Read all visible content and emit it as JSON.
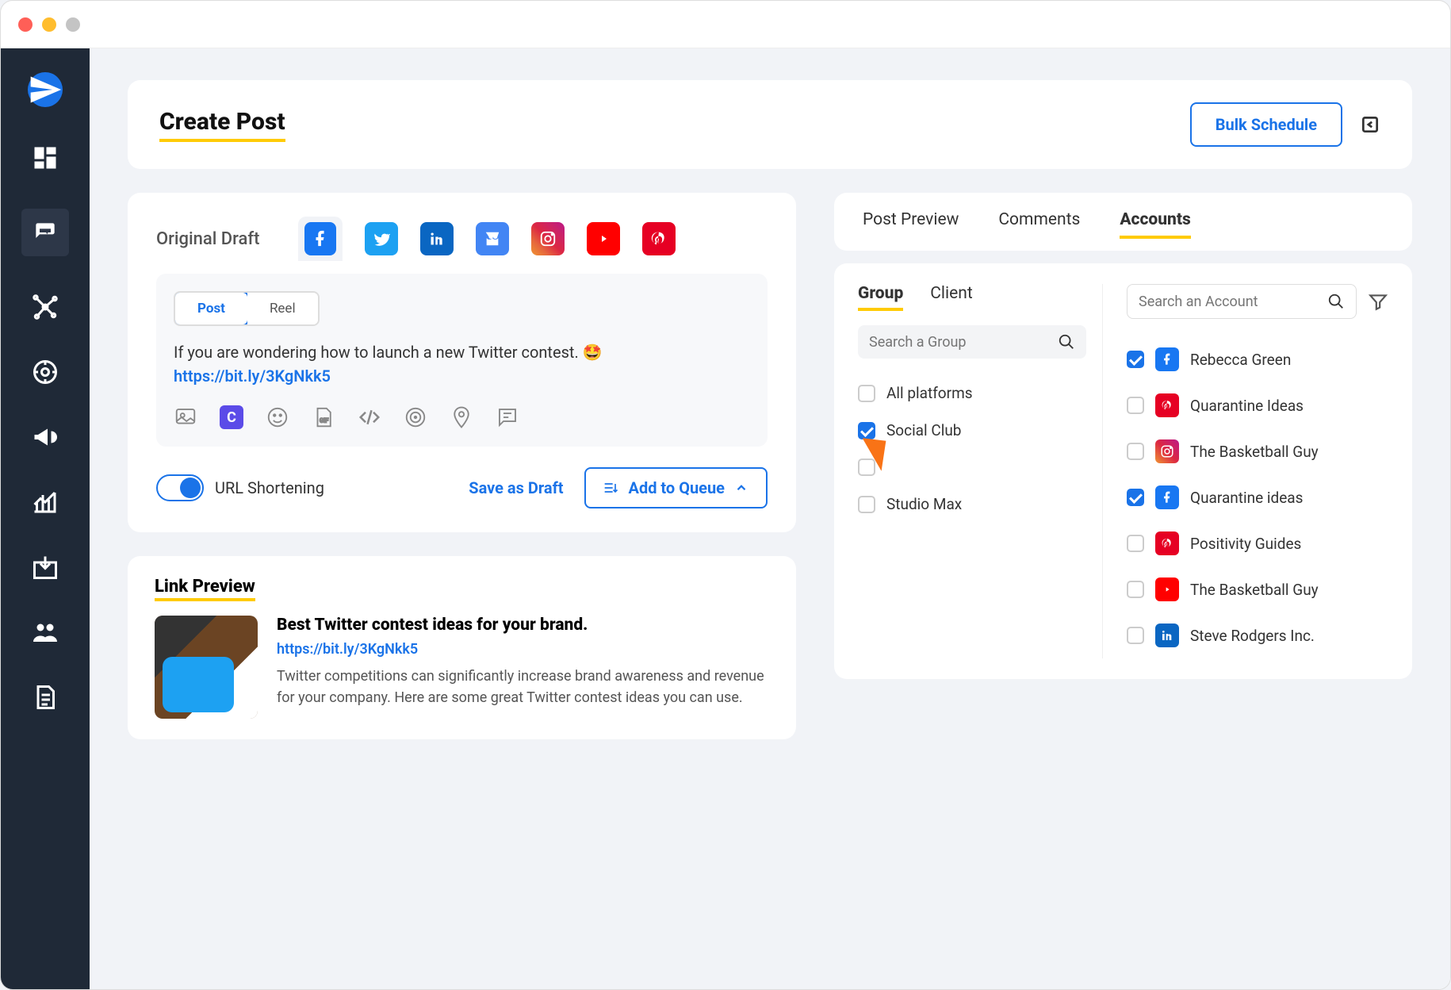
{
  "header": {
    "title": "Create Post",
    "bulk_button": "Bulk Schedule"
  },
  "editor": {
    "original_label": "Original Draft",
    "seg_post": "Post",
    "seg_reel": "Reel",
    "text": "If you are wondering how to launch a new Twitter contest. ",
    "emoji": "🤩",
    "link": "https://bit.ly/3KgNkk5",
    "url_short_label": "URL Shortening",
    "save_draft": "Save as Draft",
    "add_queue": "Add to Queue",
    "canva_letter": "C"
  },
  "link_preview": {
    "section": "Link Preview",
    "title": "Best Twitter contest ideas for your brand.",
    "url": "https://bit.ly/3KgNkk5",
    "desc": "Twitter competitions can significantly increase brand awareness and revenue for your company. Here are some great Twitter contest ideas you can use."
  },
  "right": {
    "tabs": {
      "preview": "Post Preview",
      "comments": "Comments",
      "accounts": "Accounts"
    },
    "subtabs": {
      "group": "Group",
      "client": "Client"
    },
    "group_search": "Search a Group",
    "account_search": "Search an Account",
    "groups": {
      "all": "All platforms",
      "social": "Social Club",
      "blank": "",
      "studio": "Studio Max"
    },
    "accounts": [
      {
        "name": "Rebecca Green",
        "net": "fb",
        "checked": true
      },
      {
        "name": "Quarantine Ideas",
        "net": "pt",
        "checked": false
      },
      {
        "name": "The Basketball Guy",
        "net": "ig",
        "checked": false
      },
      {
        "name": "Quarantine ideas",
        "net": "fb",
        "checked": true
      },
      {
        "name": "Positivity Guides",
        "net": "pt",
        "checked": false
      },
      {
        "name": "The Basketball Guy",
        "net": "yt",
        "checked": false
      },
      {
        "name": "Steve Rodgers Inc.",
        "net": "li",
        "checked": false
      }
    ]
  }
}
